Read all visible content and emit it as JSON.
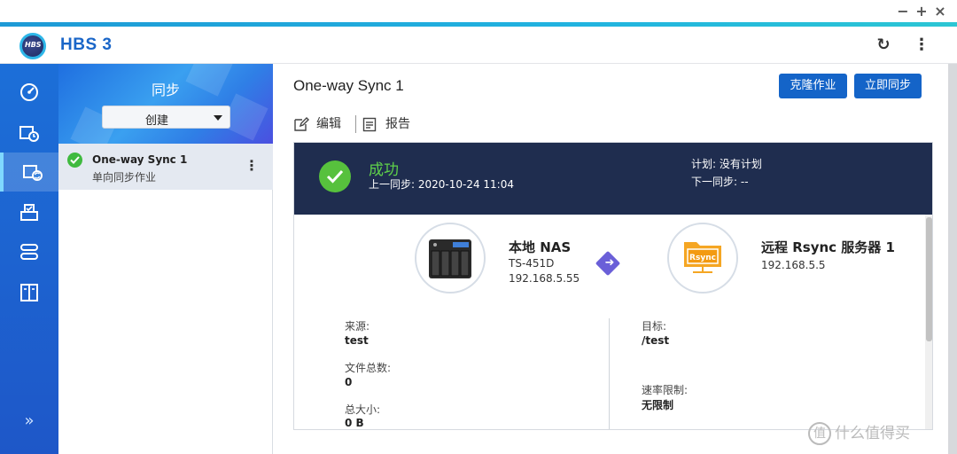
{
  "window": {
    "minimize": "−",
    "maximize": "+",
    "close": "×"
  },
  "app": {
    "logo_text": "HBS",
    "title": "HBS 3"
  },
  "header_actions": {
    "refresh": "↻",
    "more": "⋮"
  },
  "rail": {
    "items": [
      {
        "name": "overview-icon"
      },
      {
        "name": "backup-restore-icon"
      },
      {
        "name": "sync-icon"
      },
      {
        "name": "storage-icon"
      },
      {
        "name": "services-icon"
      },
      {
        "name": "logs-icon"
      }
    ],
    "expand": "»"
  },
  "sync_panel": {
    "title": "同步",
    "create_label": "创建",
    "job": {
      "name": "One-way Sync 1",
      "type": "单向同步作业",
      "menu": "⋮"
    }
  },
  "main": {
    "title": "One-way Sync 1",
    "clone_label": "克隆作业",
    "sync_now_label": "立即同步",
    "edit_label": "编辑",
    "report_label": "报告"
  },
  "status": {
    "state": "成功",
    "last_sync": "上一同步: 2020-10-24 11:04",
    "plan": "计划: 没有计划",
    "next_sync": "下一同步: --"
  },
  "source_node": {
    "title": "本地 NAS",
    "model": "TS-451D",
    "ip": "192.168.5.55"
  },
  "dest_node": {
    "title": "远程 Rsync 服务器 1",
    "ip": "192.168.5.5",
    "badge": "Rsync"
  },
  "details": {
    "source_label": "来源:",
    "source_value": "test",
    "file_count_label": "文件总数:",
    "file_count_value": "0",
    "total_size_label": "总大小:",
    "total_size_value": "0 B",
    "target_label": "目标:",
    "target_value": "/test",
    "rate_label": "速率限制:",
    "rate_value": "无限制"
  },
  "watermark": {
    "icon": "值",
    "text": "什么值得买"
  },
  "colors": {
    "brand_blue": "#1464c8",
    "rail_blue": "#1c6fd8",
    "status_band": "#1f2d4f",
    "success_green": "#57c13d"
  }
}
